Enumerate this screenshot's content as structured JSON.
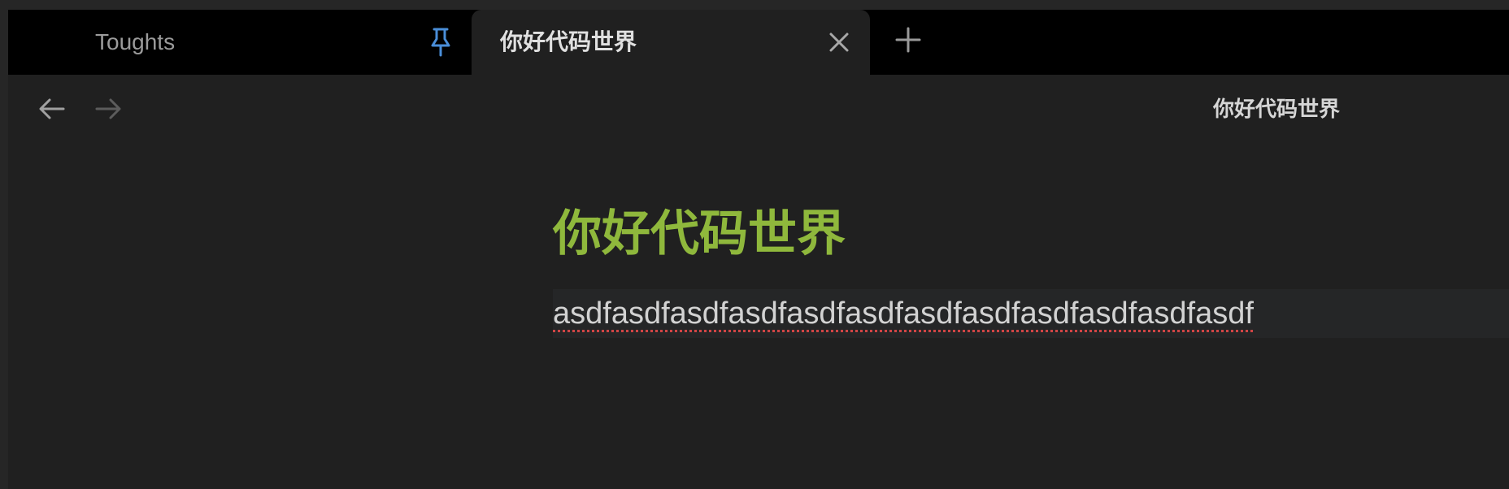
{
  "tabs": [
    {
      "label": "Toughts",
      "pinned": true,
      "icon": "pin-icon"
    },
    {
      "label": "你好代码世界",
      "active": true,
      "icon": "close-icon"
    }
  ],
  "new_tab_icon": "plus-icon",
  "nav": {
    "back_icon": "arrow-left-icon",
    "forward_icon": "arrow-right-icon"
  },
  "header": {
    "title": "你好代码世界"
  },
  "document": {
    "heading": "你好代码世界",
    "body_line": "asdfasdfasdfasdfasdfasdfasdfasdfasdfasdfasdfasdf"
  },
  "colors": {
    "background": "#202020",
    "tab_strip": "#000000",
    "heading": "#8fb83c",
    "pin_accent": "#4a8ed8",
    "spell_underline": "#d04545"
  }
}
